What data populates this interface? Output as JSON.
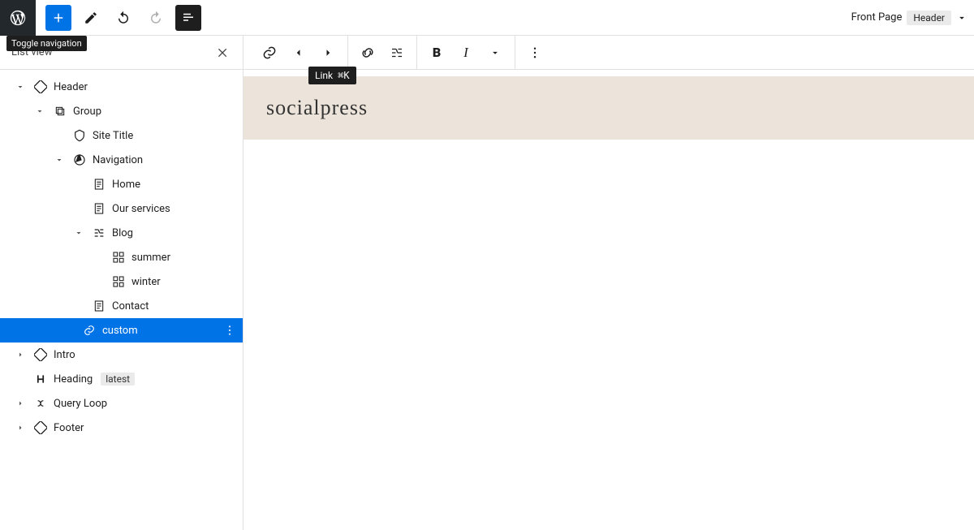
{
  "topbar": {
    "tooltip_toggle_navigation": "Toggle navigation"
  },
  "breadcrumb": {
    "page": "Front Page",
    "part": "Header"
  },
  "sidebar": {
    "title": "List view"
  },
  "tree": {
    "header": "Header",
    "group": "Group",
    "site_title": "Site Title",
    "navigation": "Navigation",
    "home": "Home",
    "services": "Our services",
    "blog": "Blog",
    "summer": "summer",
    "winter": "winter",
    "contact": "Contact",
    "custom": "custom",
    "intro": "Intro",
    "heading": "Heading",
    "heading_badge": "latest",
    "query_loop": "Query Loop",
    "footer": "Footer"
  },
  "toolbar": {
    "tooltip_link_label": "Link",
    "tooltip_link_shortcut": "⌘K"
  },
  "canvas": {
    "site_title": "socialpress"
  }
}
